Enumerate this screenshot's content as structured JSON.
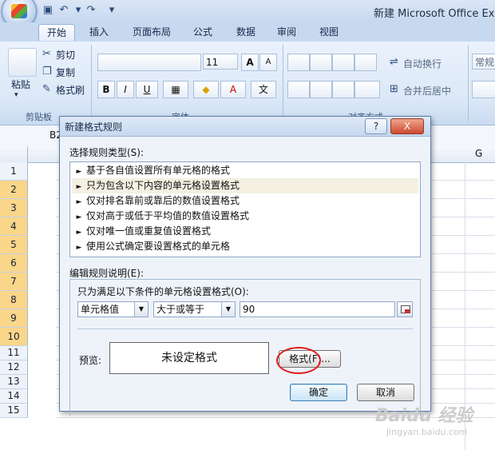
{
  "window": {
    "title": "新建 Microsoft Office Exce"
  },
  "qat": {
    "save_icon": "save-icon",
    "undo_icon": "undo-icon",
    "redo_icon": "redo-icon"
  },
  "tabs": [
    "开始",
    "插入",
    "页面布局",
    "公式",
    "数据",
    "审阅",
    "视图"
  ],
  "ribbon": {
    "clipboard": {
      "paste": "粘贴",
      "cut": "剪切",
      "copy": "复制",
      "format_painter": "格式刷",
      "group": "剪贴板"
    },
    "font": {
      "size": "11",
      "group": "字体"
    },
    "alignment": {
      "wrap_text": "自动换行",
      "merge_center": "合并后居中",
      "group": "对齐方式"
    },
    "number": {
      "format": "常规"
    }
  },
  "sheet": {
    "name_box": "B2",
    "col_g": "G",
    "rows": [
      "1",
      "2",
      "3",
      "4",
      "5",
      "6",
      "7",
      "8",
      "9",
      "10",
      "11",
      "12",
      "13",
      "14",
      "15"
    ]
  },
  "dialog": {
    "title": "新建格式规则",
    "help": "?",
    "close": "X",
    "select_rule_type_label": "选择规则类型(S):",
    "rule_types": [
      "基于各自值设置所有单元格的格式",
      "只为包含以下内容的单元格设置格式",
      "仅对排名靠前或靠后的数值设置格式",
      "仅对高于或低于平均值的数值设置格式",
      "仅对唯一值或重复值设置格式",
      "使用公式确定要设置格式的单元格"
    ],
    "selected_rule_index": 1,
    "edit_rule_label": "编辑规则说明(E):",
    "condition_label": "只为满足以下条件的单元格设置格式(O):",
    "cond_field": "单元格值",
    "cond_operator": "大于或等于",
    "cond_value": "90",
    "preview_label": "预览:",
    "preview_text": "未设定格式",
    "format_button": "格式(F)...",
    "ok": "确定",
    "cancel": "取消"
  },
  "watermark": {
    "text": "Baidu 经验",
    "url": "jingyan.baidu.com"
  }
}
